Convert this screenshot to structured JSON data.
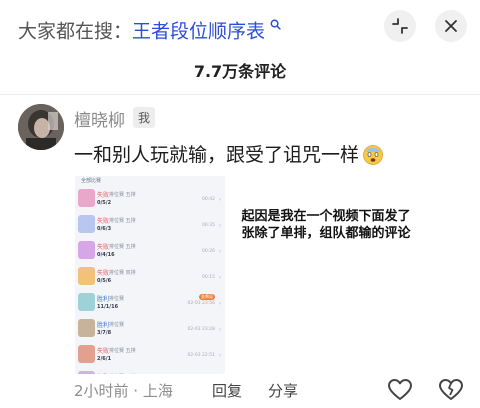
{
  "header": {
    "search_prefix": "大家都在搜：",
    "search_query": "王者段位顺序表",
    "search_icon": "search-icon",
    "collapse_icon": "collapse-icon",
    "close_icon": "close-icon"
  },
  "comment_count": "7.7万条评论",
  "comment": {
    "username": "檀晓柳",
    "me_tag": "我",
    "text": "一和别人玩就输，跟受了诅咒一样",
    "emoji": "scared-face-emoji",
    "meta": "2小时前 · 上海",
    "reply_label": "回复",
    "share_label": "分享",
    "like_icon": "heart-icon",
    "dislike_icon": "broken-heart-icon"
  },
  "annotation": "起因是我在一个视频下面发了张除了单排，组队都输的评论",
  "match_screenshot": {
    "header": "全部比赛",
    "rows": [
      {
        "result": "失败",
        "mode": "排位赛 五排",
        "kda": "0/5/2",
        "time": "00:42",
        "win": false,
        "badge": ""
      },
      {
        "result": "失败",
        "mode": "排位赛 五排",
        "kda": "0/6/3",
        "time": "00:35",
        "win": false,
        "badge": ""
      },
      {
        "result": "失败",
        "mode": "排位赛 五排",
        "kda": "0/4/16",
        "time": "00:26",
        "win": false,
        "badge": ""
      },
      {
        "result": "失败",
        "mode": "排位赛 双排",
        "kda": "0/5/6",
        "time": "00:15",
        "win": false,
        "badge": ""
      },
      {
        "result": "胜利",
        "mode": "排位赛",
        "kda": "11/1/16",
        "time": "02-03 23:56",
        "win": true,
        "badge": "金牌局"
      },
      {
        "result": "胜利",
        "mode": "排位赛",
        "kda": "3/7/8",
        "time": "02-03 23:28",
        "win": true,
        "badge": ""
      },
      {
        "result": "失败",
        "mode": "排位赛 五排",
        "kda": "2/6/1",
        "time": "02-03 22:51",
        "win": false,
        "badge": ""
      },
      {
        "result": "失败",
        "mode": "排位赛 五排",
        "kda": "",
        "time": "",
        "win": false,
        "badge": ""
      }
    ]
  },
  "colors": {
    "query_blue": "#2a4fd6",
    "loss_red": "#e75b5b",
    "win_blue": "#3a74e0"
  }
}
